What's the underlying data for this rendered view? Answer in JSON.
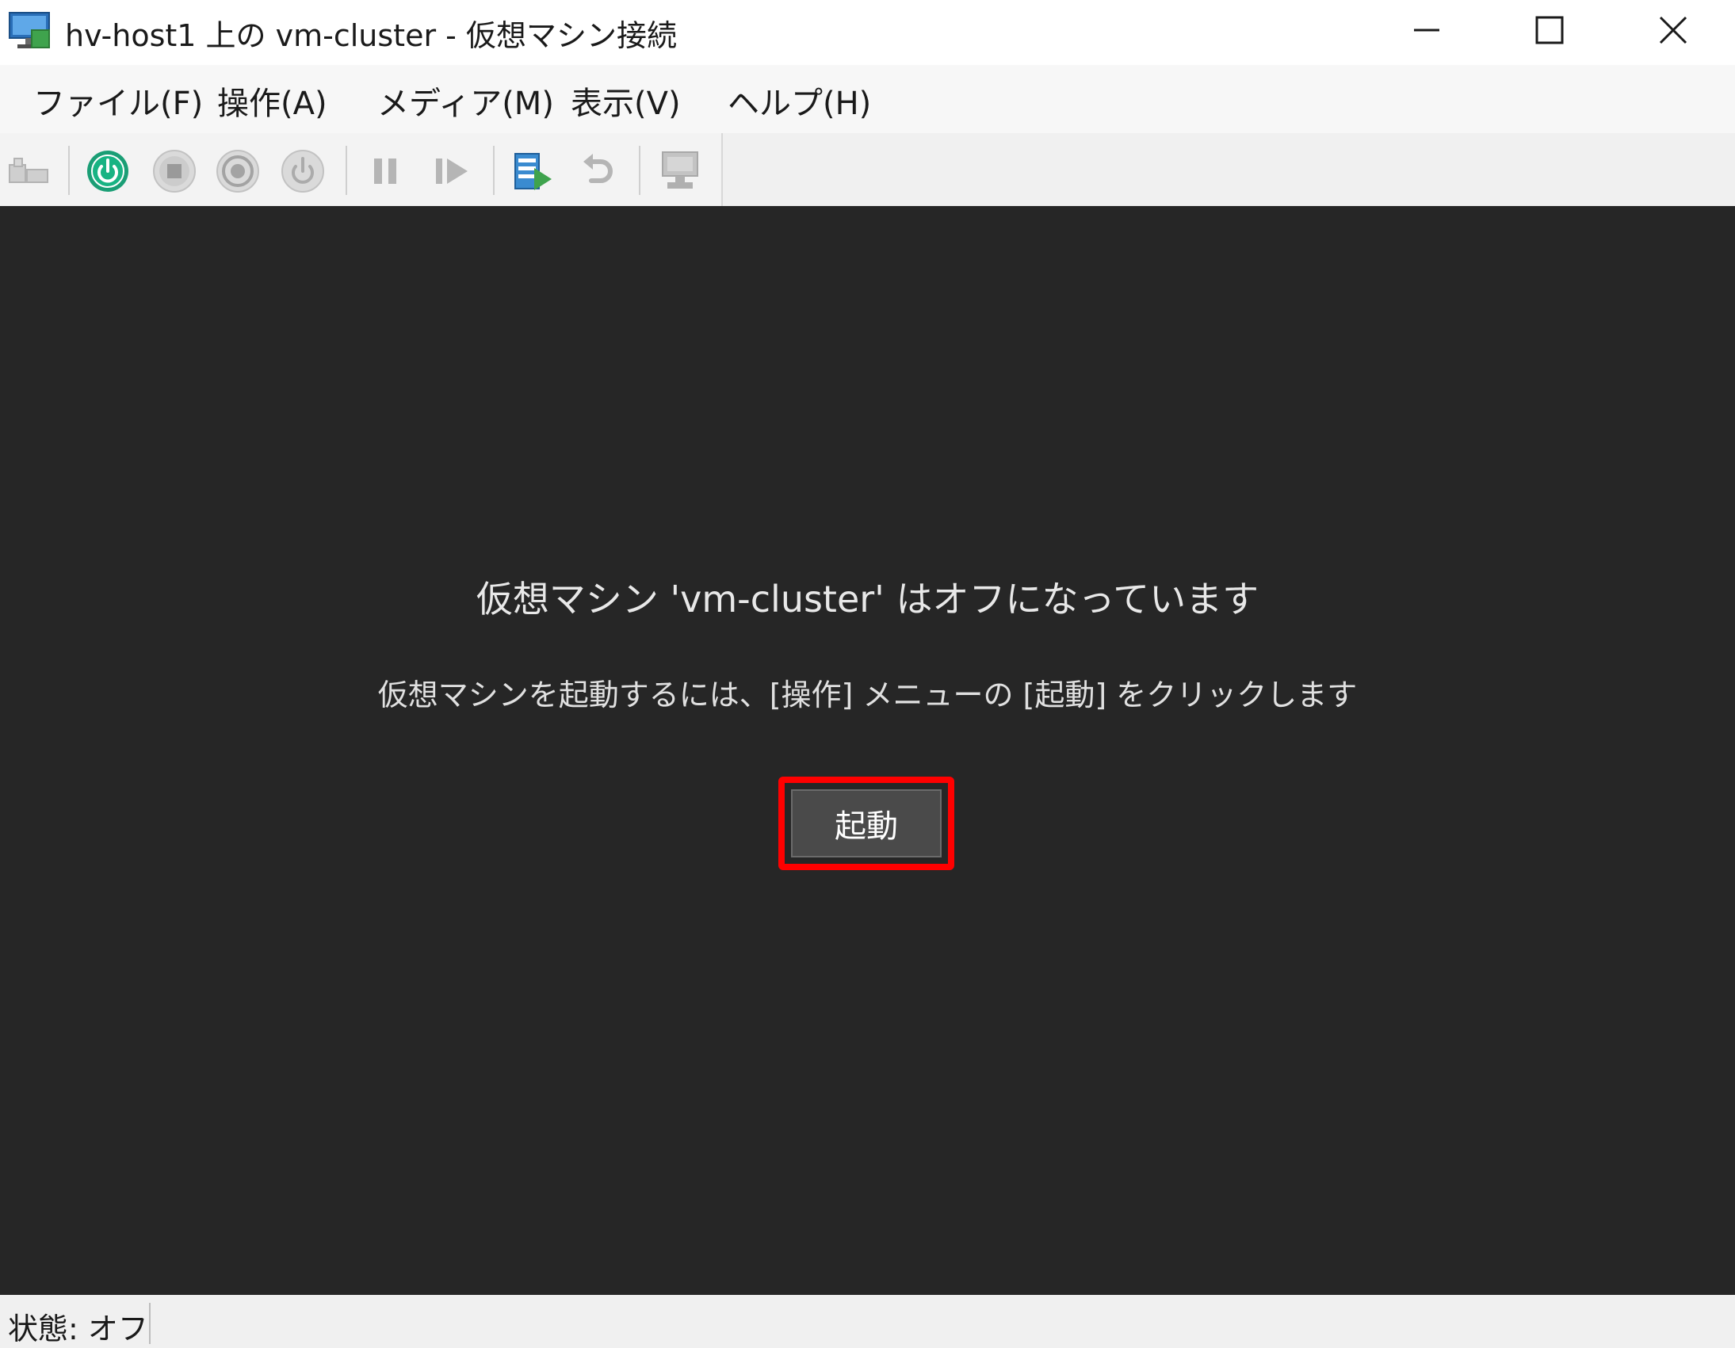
{
  "window": {
    "title": "hv-host1 上の vm-cluster - 仮想マシン接続",
    "controls": {
      "minimize": "minimize-icon",
      "maximize": "maximize-icon",
      "close": "close-icon"
    }
  },
  "menubar": {
    "items": [
      {
        "label": "ファイル(F)"
      },
      {
        "label": "操作(A)"
      },
      {
        "label": "メディア(M)"
      },
      {
        "label": "表示(V)"
      },
      {
        "label": "ヘルプ(H)"
      }
    ]
  },
  "toolbar": {
    "icons": [
      "ctrl-alt-del-icon",
      "start-icon",
      "turn-off-icon",
      "shut-down-icon",
      "save-icon",
      "pause-icon",
      "resume-icon",
      "checkpoint-icon",
      "revert-icon",
      "enhanced-session-icon"
    ],
    "start_color": "#1a9e75"
  },
  "console": {
    "title": "仮想マシン 'vm-cluster' はオフになっています",
    "subtitle": "仮想マシンを起動するには、[操作] メニューの [起動] をクリックします",
    "start_button": "起動",
    "highlight_color": "#ff0000"
  },
  "status": {
    "text": "状態: オフ"
  }
}
